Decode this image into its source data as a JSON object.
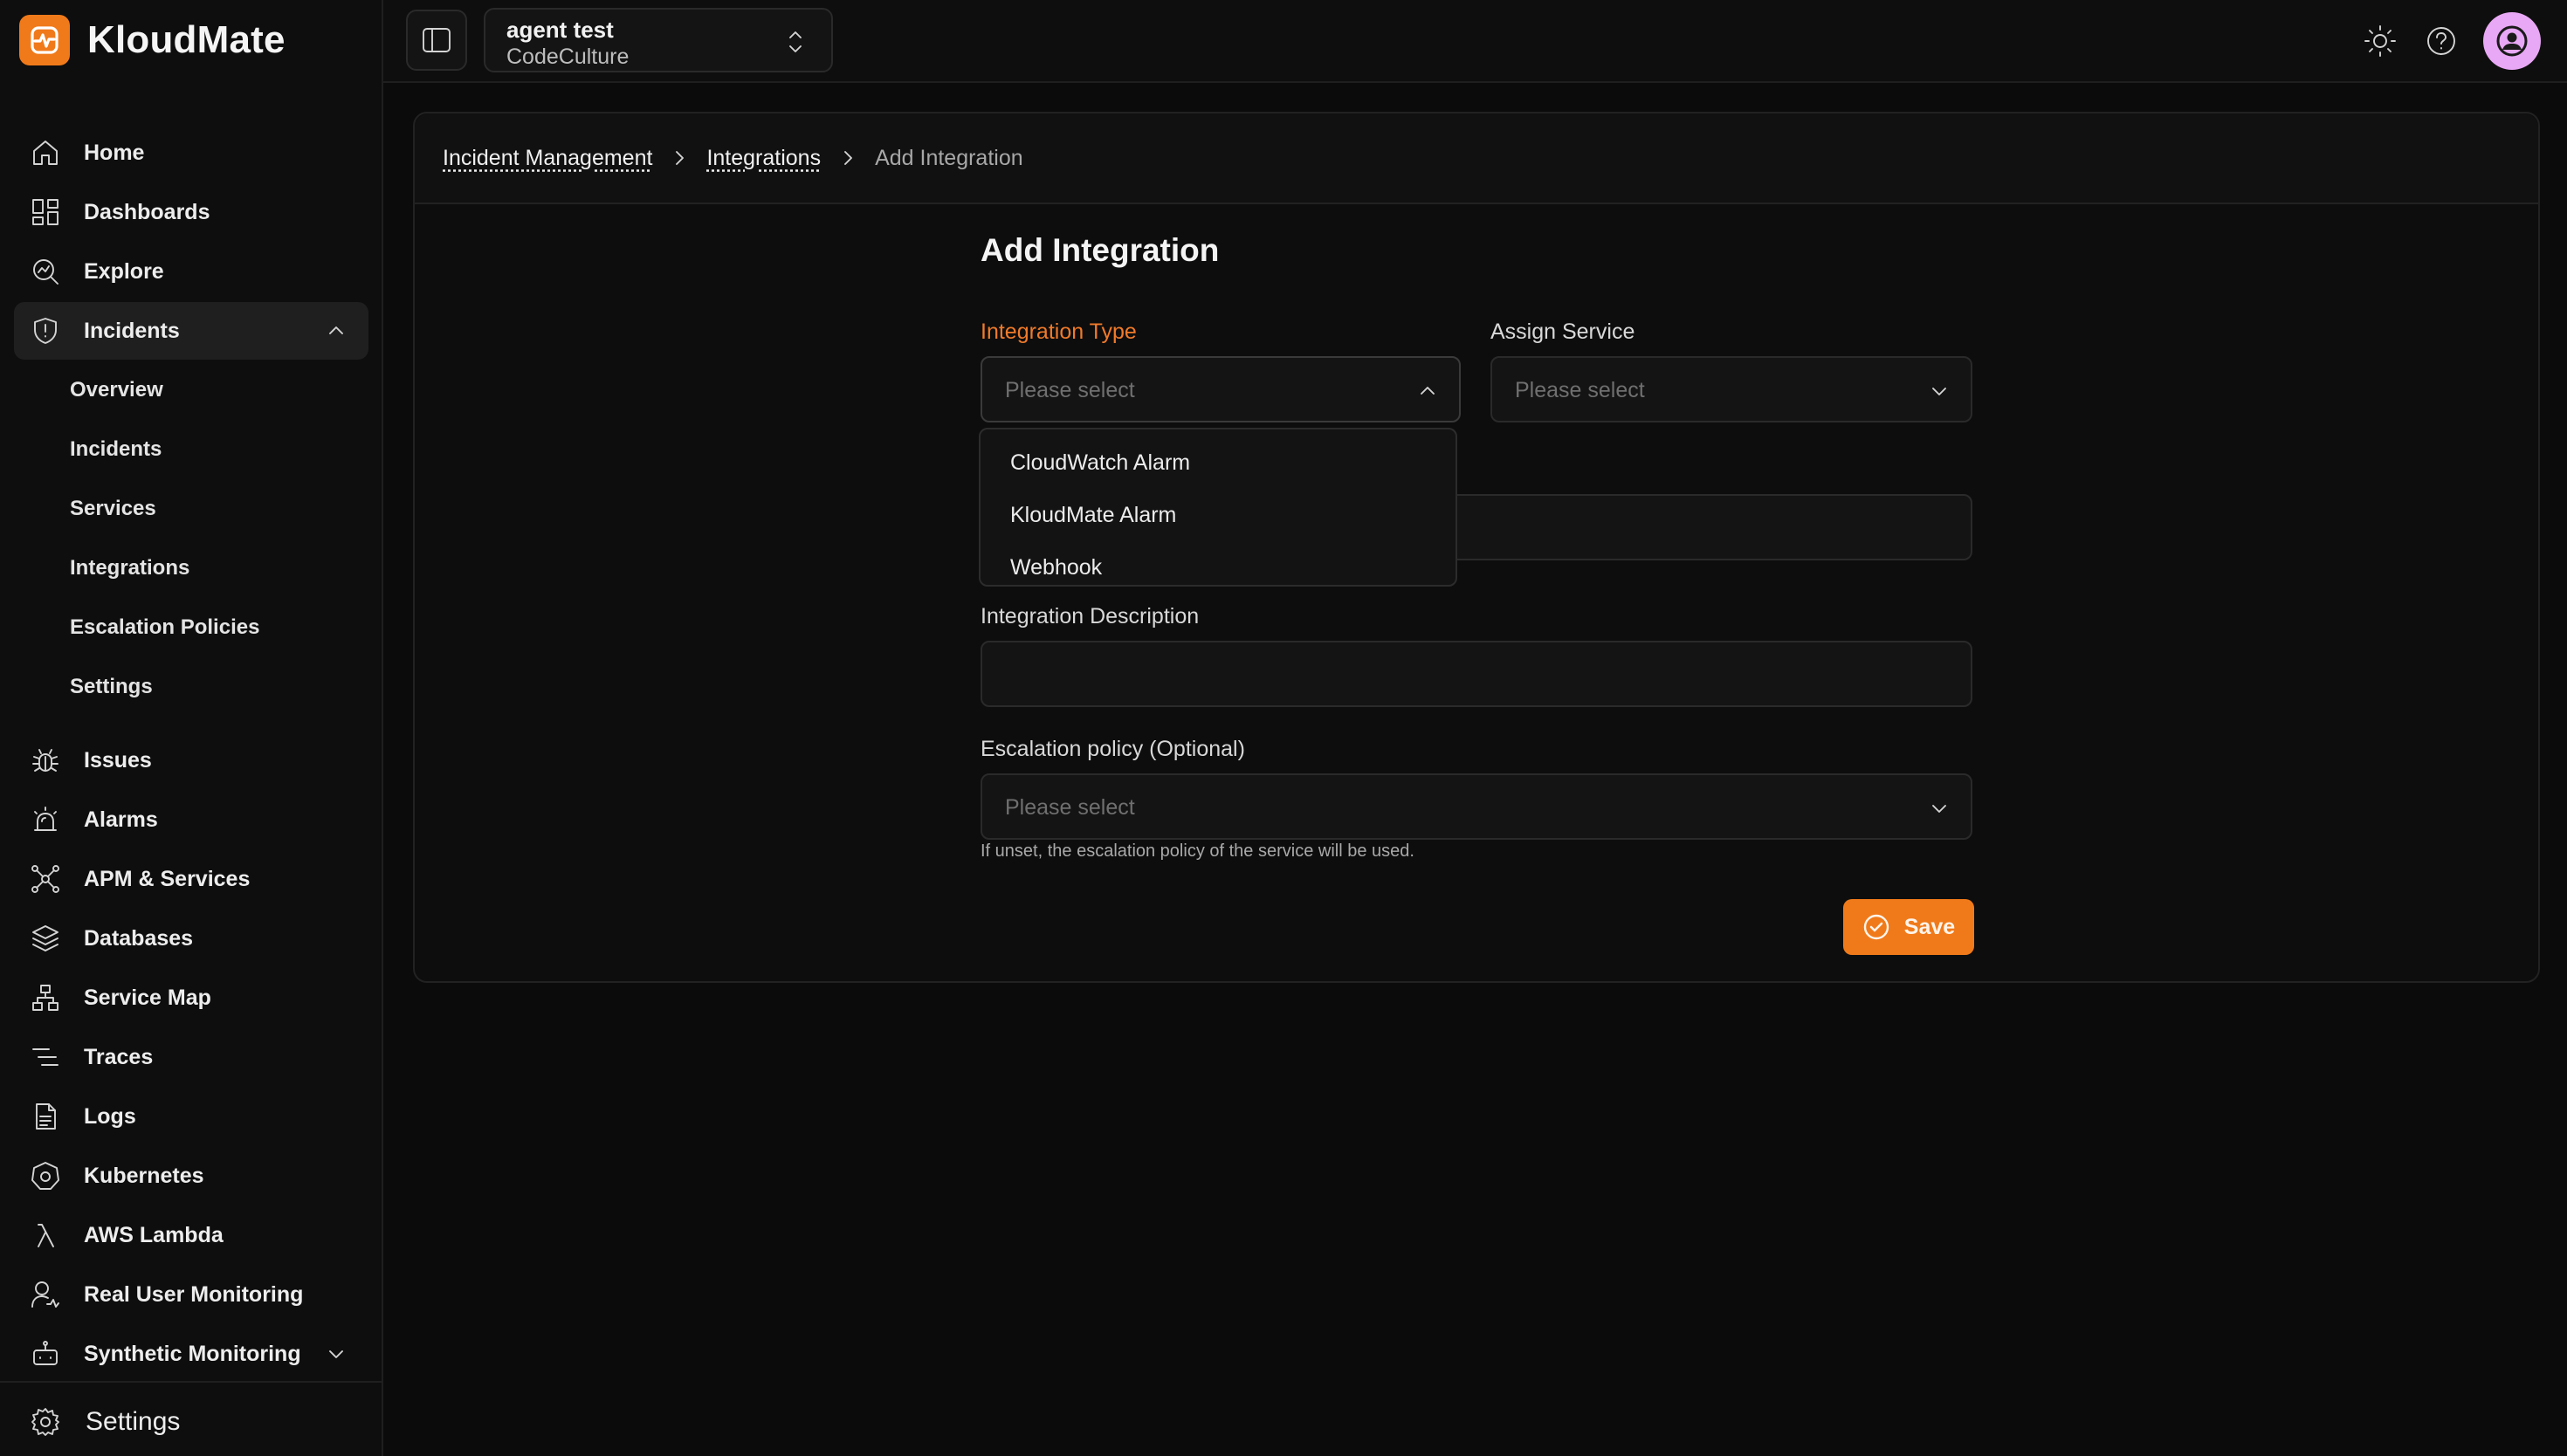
{
  "brand": {
    "name": "KloudMate",
    "accent": "#f07a1a"
  },
  "sidebar": {
    "items": [
      {
        "label": "Home"
      },
      {
        "label": "Dashboards"
      },
      {
        "label": "Explore"
      },
      {
        "label": "Incidents"
      },
      {
        "label": "Issues"
      },
      {
        "label": "Alarms"
      },
      {
        "label": "APM & Services"
      },
      {
        "label": "Databases"
      },
      {
        "label": "Service Map"
      },
      {
        "label": "Traces"
      },
      {
        "label": "Logs"
      },
      {
        "label": "Kubernetes"
      },
      {
        "label": "AWS Lambda"
      },
      {
        "label": "Real User Monitoring"
      },
      {
        "label": "Synthetic Monitoring"
      }
    ],
    "incidents_sub": [
      {
        "label": "Overview"
      },
      {
        "label": "Incidents"
      },
      {
        "label": "Services"
      },
      {
        "label": "Integrations"
      },
      {
        "label": "Escalation Policies"
      },
      {
        "label": "Settings"
      }
    ],
    "footer_label": "Settings"
  },
  "topbar": {
    "org_name": "agent test",
    "org_sub": "CodeCulture"
  },
  "breadcrumb": {
    "items": [
      "Incident Management",
      "Integrations"
    ],
    "current": "Add Integration"
  },
  "form": {
    "title": "Add Integration",
    "integration_type_label": "Integration Type",
    "integration_type_placeholder": "Please select",
    "assign_service_label": "Assign Service",
    "assign_service_placeholder": "Please select",
    "integration_name_value": "",
    "description_label": "Integration Description",
    "description_value": "",
    "escalation_label": "Escalation policy (Optional)",
    "escalation_placeholder": "Please select",
    "escalation_hint": "If unset, the escalation policy of the service will be used.",
    "save_label": "Save"
  },
  "dropdown": {
    "options": [
      "CloudWatch Alarm",
      "KloudMate Alarm",
      "Webhook"
    ]
  }
}
